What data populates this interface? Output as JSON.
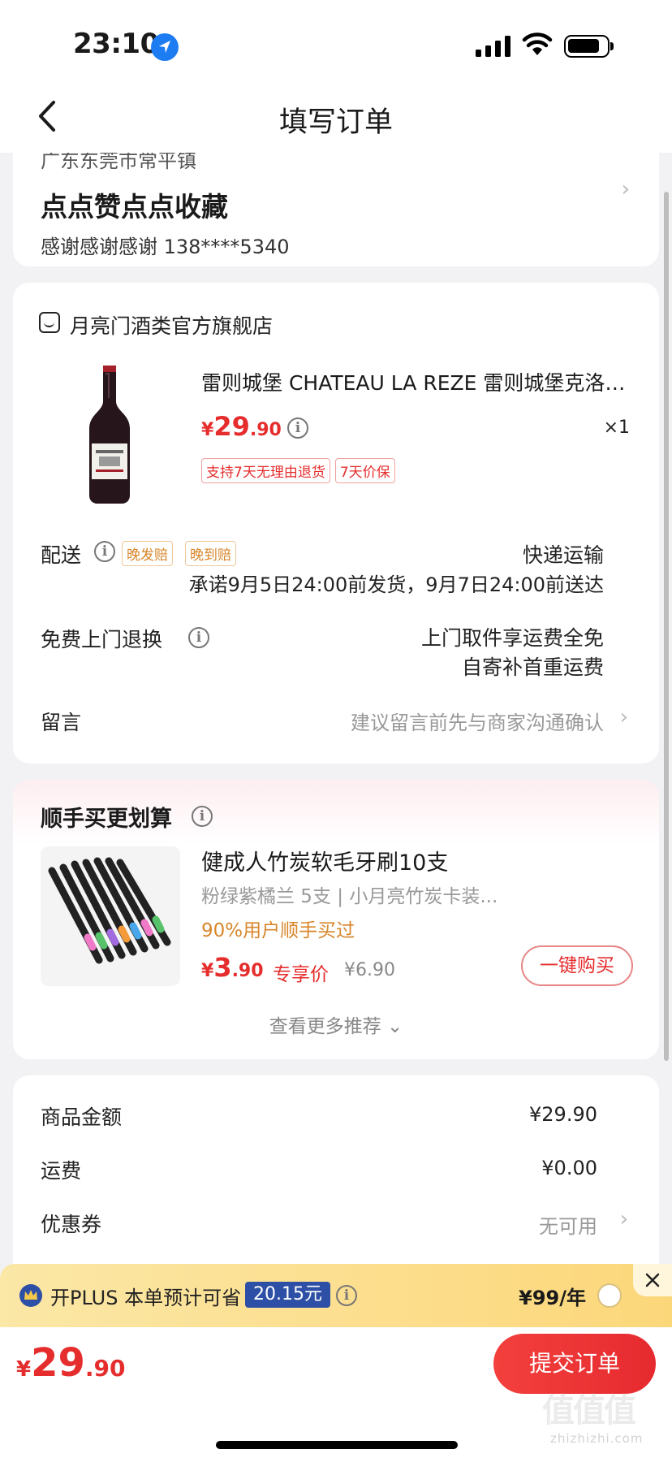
{
  "status_bar": {
    "time": "23:10"
  },
  "nav": {
    "title": "填写订单"
  },
  "address": {
    "region": "广东东莞市常平镇",
    "name": "点点赞点点收藏",
    "contact": "感谢感谢感谢  138****5340"
  },
  "shop": {
    "name": "月亮门酒类官方旗舰店",
    "product": {
      "title": "雷则城堡 CHATEAU LA REZE 雷则城堡克洛斯干红葡萄酒",
      "price_currency": "¥",
      "price_int": "29",
      "price_dec": ".90",
      "quantity": "×1",
      "tags": [
        "支持7天无理由退货",
        "7天价保"
      ]
    }
  },
  "delivery": {
    "label": "配送",
    "badges": [
      "晚发赔",
      "晚到赔"
    ],
    "method": "快递运输",
    "promise": "承诺9月5日24:00前发货，9月7日24:00前送达"
  },
  "free_return": {
    "label": "免费上门退换",
    "desc1": "上门取件享运费全免",
    "desc2": "自寄补首重运费"
  },
  "message": {
    "label": "留言",
    "placeholder": "建议留言前先与商家沟通确认"
  },
  "recommendation": {
    "title": "顺手买更划算",
    "item_name": "健成人竹炭软毛牙刷10支",
    "item_spec": "粉绿紫橘兰 5支 | 小月亮竹炭卡装...",
    "buyers": "90%用户顺手买过",
    "price_currency": "¥",
    "price_int": "3",
    "price_dec": ".90",
    "price_tag": "专享价",
    "original_price": "¥6.90",
    "buy_label": "一键购买",
    "more_label": "查看更多推荐 ⌄"
  },
  "summary": {
    "rows": [
      {
        "label": "商品金额",
        "value": "¥29.90"
      },
      {
        "label": "运费",
        "value": "¥0.00"
      },
      {
        "label": "优惠券",
        "value": "无可用"
      }
    ]
  },
  "plus": {
    "text": "开PLUS 本单预计可省",
    "saving": "20.15元",
    "price": "¥99/年"
  },
  "footer": {
    "total_currency": "¥",
    "total_int": "29",
    "total_dec": ".90",
    "submit_label": "提交订单"
  },
  "watermark": {
    "logo": "值值值",
    "domain": "zhizhizhi.com"
  },
  "colors": {
    "accent": "#e62d2d",
    "plus_blue": "#2d4fa5",
    "warn_orange": "#d8862b"
  }
}
